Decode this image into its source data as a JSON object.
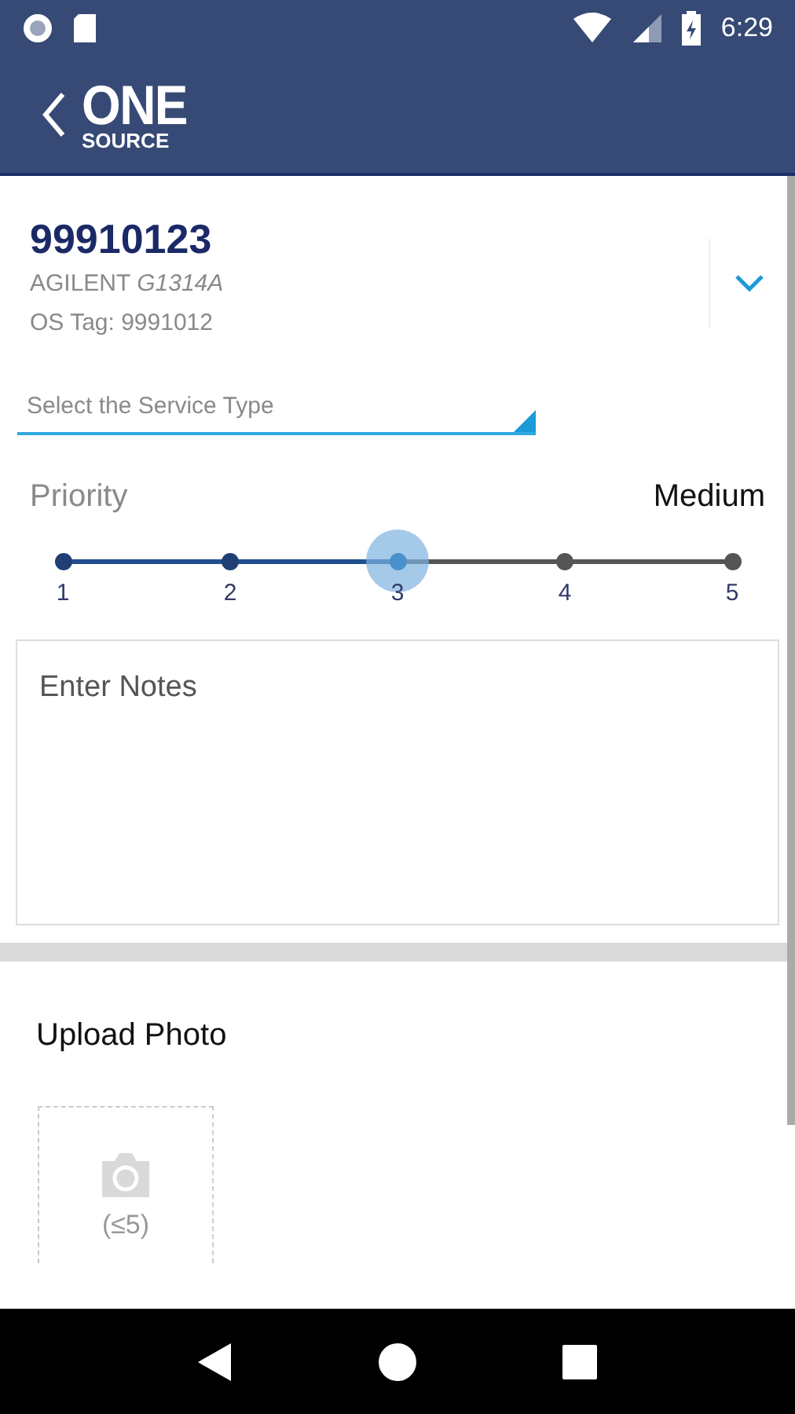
{
  "status_bar": {
    "time": "6:29"
  },
  "app_bar": {
    "logo_top": "ONE",
    "logo_bottom": "SOURCE"
  },
  "asset": {
    "number": "99910123",
    "model": "AGILENT *G1314A*",
    "tag": "OS Tag: 9991012",
    "expanded": false
  },
  "service_type": {
    "placeholder": "Select the Service Type"
  },
  "priority": {
    "label": "Priority",
    "value": "Medium",
    "level": 0.5,
    "steps": [
      {
        "label": "1",
        "selected": false
      },
      {
        "label": "2",
        "selected": false
      },
      {
        "label": "3",
        "selected": true
      },
      {
        "label": "4",
        "selected": false
      },
      {
        "label": "5",
        "selected": false
      }
    ]
  },
  "notes": {
    "placeholder": "Enter Notes"
  },
  "upload": {
    "title": "Upload Photo",
    "hint": "(≤5)"
  }
}
